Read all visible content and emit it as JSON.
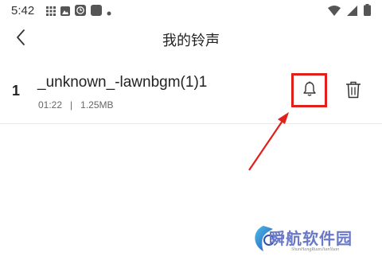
{
  "status_bar": {
    "time": "5:42",
    "left_icons": [
      "grid-app-icon",
      "gallery-notification-icon",
      "clock-app-icon",
      "app-square-icon",
      "dot-indicator-icon"
    ],
    "right_icons": [
      "wifi-icon",
      "cellular-signal-icon",
      "battery-icon"
    ]
  },
  "app_bar": {
    "title": "我的铃声",
    "back_icon": "chevron-left-icon"
  },
  "track_list": [
    {
      "index": "1",
      "name": "_unknown_-lawnbgm(1)1",
      "duration": "01:22",
      "separator": "|",
      "size": "1.25MB",
      "set_icon": "bell-icon",
      "delete_icon": "trash-icon"
    }
  ],
  "annotation": {
    "color": "#e0201b"
  },
  "watermark": {
    "text": "瞬航软件园",
    "subtext": "ShunHangRuanJianYuan"
  }
}
